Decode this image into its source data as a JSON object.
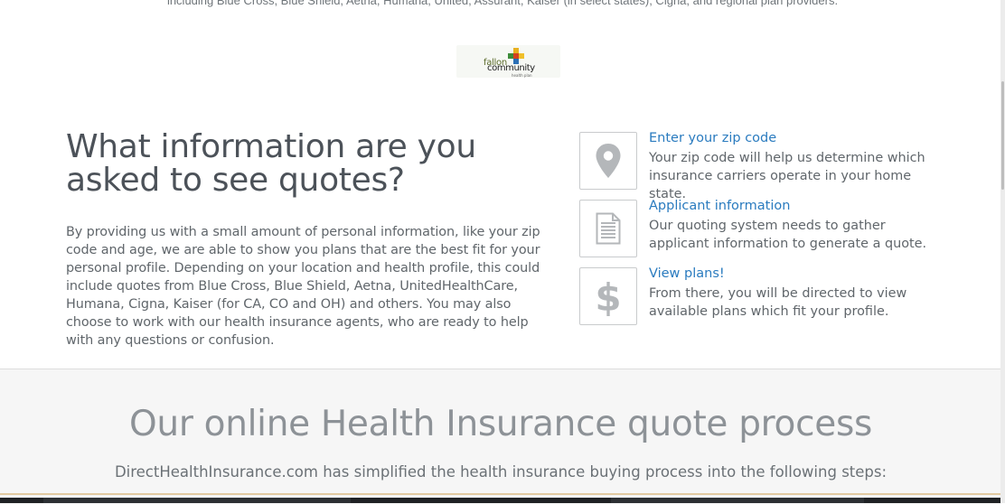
{
  "intro": {
    "carriers_text": "including Blue Cross, Blue Shield, Aetna, Humana, United, Assurant, Kaiser (in select states), Cigna, and regional plan providers."
  },
  "logo": {
    "word1": "fallon",
    "word2": "community",
    "word3": "health plan",
    "icon": "fallon-cross-logo-icon"
  },
  "info": {
    "heading": "What information are you asked to see quotes?",
    "paragraph": "By providing us with a small amount of personal information, like your zip code and age, we are able to show you plans that are the best fit for your personal profile. Depending on your location and health profile, this could include quotes from Blue Cross, Blue Shield, Aetna, UnitedHealthCare, Humana, Cigna, Kaiser (for CA, CO and OH) and others. You may also choose to work with our health insurance agents, who are ready to help with any questions or confusion."
  },
  "steps": [
    {
      "icon": "map-pin-icon",
      "title": "Enter your zip code",
      "desc": "Your zip code will help us determine which insurance carriers operate in your home state."
    },
    {
      "icon": "document-icon",
      "title": "Applicant information",
      "desc": "Our quoting system needs to gather applicant information to generate a quote."
    },
    {
      "icon": "dollar-sign-icon",
      "title": "View plans!",
      "desc": "From there, you will be directed to view available plans which fit your profile."
    }
  ],
  "process": {
    "heading": "Our online Health Insurance quote process",
    "subheading": "DirectHealthInsurance.com has simplified the health insurance buying process into the following steps:"
  },
  "colors": {
    "link": "#2a7bbf",
    "heading": "#4c5259",
    "body_text": "#60666b",
    "section_bg": "#f6f6f6"
  }
}
